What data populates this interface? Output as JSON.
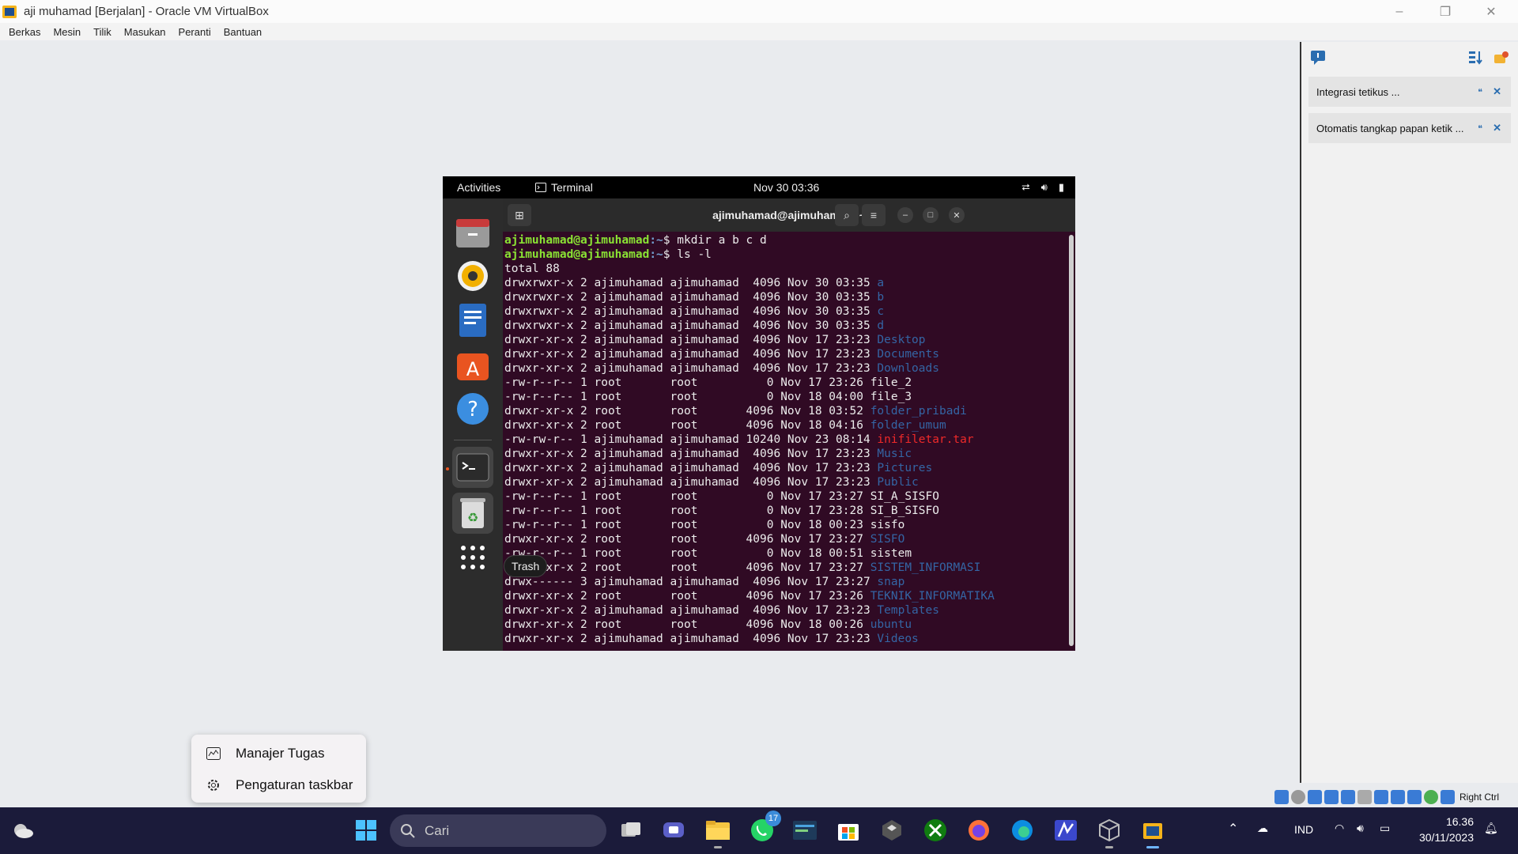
{
  "window": {
    "title": "aji muhamad  [Berjalan] - Oracle VM VirtualBox"
  },
  "menu": [
    "Berkas",
    "Mesin",
    "Tilik",
    "Masukan",
    "Peranti",
    "Bantuan"
  ],
  "notifications": [
    {
      "text": "Integrasi tetikus ..."
    },
    {
      "text": "Otomatis tangkap papan ketik ..."
    }
  ],
  "guest": {
    "topbar": {
      "activities": "Activities",
      "app": "Terminal",
      "clock": "Nov 30  03:36"
    },
    "tooltip": "Trash",
    "dock": [
      "files-icon",
      "rhythmbox-icon",
      "writer-icon",
      "software-icon",
      "help-icon",
      "terminal-icon",
      "trash-icon",
      "apps-grid-icon"
    ],
    "terminal": {
      "title": "ajimuhamad@ajimuhamad: ~",
      "prompt_user": "ajimuhamad@ajimuhamad",
      "prompt_dir": ":~",
      "commands": [
        "$ mkdir a b c d",
        "$ ls -l"
      ],
      "total": "total 88",
      "rows": [
        {
          "meta": "drwxrwxr-x 2 ajimuhamad ajimuhamad  4096 Nov 30 03:35 ",
          "name": "a",
          "kind": "dir"
        },
        {
          "meta": "drwxrwxr-x 2 ajimuhamad ajimuhamad  4096 Nov 30 03:35 ",
          "name": "b",
          "kind": "dir"
        },
        {
          "meta": "drwxrwxr-x 2 ajimuhamad ajimuhamad  4096 Nov 30 03:35 ",
          "name": "c",
          "kind": "dir"
        },
        {
          "meta": "drwxrwxr-x 2 ajimuhamad ajimuhamad  4096 Nov 30 03:35 ",
          "name": "d",
          "kind": "dir"
        },
        {
          "meta": "drwxr-xr-x 2 ajimuhamad ajimuhamad  4096 Nov 17 23:23 ",
          "name": "Desktop",
          "kind": "dir"
        },
        {
          "meta": "drwxr-xr-x 2 ajimuhamad ajimuhamad  4096 Nov 17 23:23 ",
          "name": "Documents",
          "kind": "dir"
        },
        {
          "meta": "drwxr-xr-x 2 ajimuhamad ajimuhamad  4096 Nov 17 23:23 ",
          "name": "Downloads",
          "kind": "dir"
        },
        {
          "meta": "-rw-r--r-- 1 root       root          0 Nov 17 23:26 ",
          "name": "file_2",
          "kind": "file"
        },
        {
          "meta": "-rw-r--r-- 1 root       root          0 Nov 18 04:00 ",
          "name": "file_3",
          "kind": "file"
        },
        {
          "meta": "drwxr-xr-x 2 root       root       4096 Nov 18 03:52 ",
          "name": "folder_pribadi",
          "kind": "dir"
        },
        {
          "meta": "drwxr-xr-x 2 root       root       4096 Nov 18 04:16 ",
          "name": "folder_umum",
          "kind": "dir"
        },
        {
          "meta": "-rw-rw-r-- 1 ajimuhamad ajimuhamad 10240 Nov 23 08:14 ",
          "name": "inifiletar.tar",
          "kind": "archive"
        },
        {
          "meta": "drwxr-xr-x 2 ajimuhamad ajimuhamad  4096 Nov 17 23:23 ",
          "name": "Music",
          "kind": "dir"
        },
        {
          "meta": "drwxr-xr-x 2 ajimuhamad ajimuhamad  4096 Nov 17 23:23 ",
          "name": "Pictures",
          "kind": "dir"
        },
        {
          "meta": "drwxr-xr-x 2 ajimuhamad ajimuhamad  4096 Nov 17 23:23 ",
          "name": "Public",
          "kind": "dir"
        },
        {
          "meta": "-rw-r--r-- 1 root       root          0 Nov 17 23:27 ",
          "name": "SI_A_SISFO",
          "kind": "file"
        },
        {
          "meta": "-rw-r--r-- 1 root       root          0 Nov 17 23:28 ",
          "name": "SI_B_SISFO",
          "kind": "file"
        },
        {
          "meta": "-rw-r--r-- 1 root       root          0 Nov 18 00:23 ",
          "name": "sisfo",
          "kind": "file"
        },
        {
          "meta": "drwxr-xr-x 2 root       root       4096 Nov 17 23:27 ",
          "name": "SISFO",
          "kind": "dir"
        },
        {
          "meta": "-rw-r--r-- 1 root       root          0 Nov 18 00:51 ",
          "name": "sistem",
          "kind": "file"
        },
        {
          "meta": "drwxr-xr-x 2 root       root       4096 Nov 17 23:27 ",
          "name": "SISTEM_INFORMASI",
          "kind": "dir"
        },
        {
          "meta": "drwx------ 3 ajimuhamad ajimuhamad  4096 Nov 17 23:27 ",
          "name": "snap",
          "kind": "dir"
        },
        {
          "meta": "drwxr-xr-x 2 root       root       4096 Nov 17 23:26 ",
          "name": "TEKNIK_INFORMATIKA",
          "kind": "dir"
        },
        {
          "meta": "drwxr-xr-x 2 ajimuhamad ajimuhamad  4096 Nov 17 23:23 ",
          "name": "Templates",
          "kind": "dir"
        },
        {
          "meta": "drwxr-xr-x 2 root       root       4096 Nov 18 00:26 ",
          "name": "ubuntu",
          "kind": "dir"
        },
        {
          "meta": "drwxr-xr-x 2 ajimuhamad ajimuhamad  4096 Nov 17 23:23 ",
          "name": "Videos",
          "kind": "dir"
        }
      ]
    }
  },
  "context_menu": [
    {
      "label": "Manajer Tugas",
      "icon": "task-manager-icon"
    },
    {
      "label": "Pengaturan taskbar",
      "icon": "settings-icon"
    }
  ],
  "vb_status": {
    "host_key": "Right Ctrl"
  },
  "taskbar": {
    "search_placeholder": "Cari",
    "whatsapp_badge": "17",
    "language": "IND",
    "time": "16.36",
    "date": "30/11/2023"
  },
  "colors": {
    "terminal_bg": "#300a24",
    "prompt_user": "#8ae234",
    "dir": "#3465a4",
    "archive": "#ef2929",
    "taskbar": "#1b1b3a"
  }
}
